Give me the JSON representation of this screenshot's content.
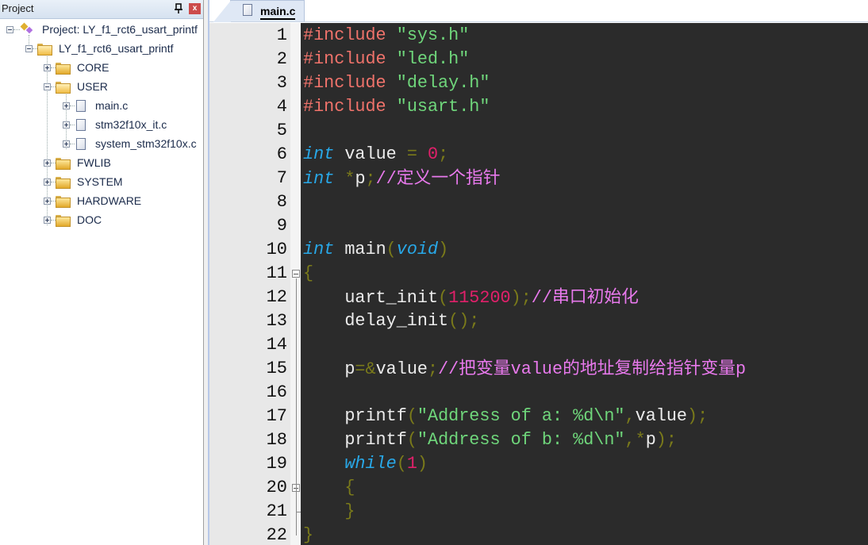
{
  "project_panel": {
    "title": "Project",
    "pin_icon": "pin-icon",
    "close_icon": "close-icon",
    "tree": [
      {
        "label": "Project: LY_f1_rct6_usart_printf",
        "type": "project",
        "expanded": true
      },
      {
        "label": "LY_f1_rct6_usart_printf",
        "type": "target",
        "expanded": true
      },
      {
        "label": "CORE",
        "type": "folder",
        "expanded": false
      },
      {
        "label": "USER",
        "type": "folder",
        "expanded": true
      },
      {
        "label": "main.c",
        "type": "file"
      },
      {
        "label": "stm32f10x_it.c",
        "type": "file"
      },
      {
        "label": "system_stm32f10x.c",
        "type": "file"
      },
      {
        "label": "FWLIB",
        "type": "folder",
        "expanded": false
      },
      {
        "label": "SYSTEM",
        "type": "folder",
        "expanded": false
      },
      {
        "label": "HARDWARE",
        "type": "folder",
        "expanded": false
      },
      {
        "label": "DOC",
        "type": "folder",
        "expanded": false
      }
    ]
  },
  "editor": {
    "active_tab": "main.c",
    "line_numbers": [
      "1",
      "2",
      "3",
      "4",
      "5",
      "6",
      "7",
      "8",
      "9",
      "10",
      "11",
      "12",
      "13",
      "14",
      "15",
      "16",
      "17",
      "18",
      "19",
      "20",
      "21",
      "22"
    ],
    "fold_markers_at_lines": [
      11,
      20
    ],
    "lines": [
      [
        {
          "c": "pp",
          "t": "#include "
        },
        {
          "c": "str",
          "t": "\"sys.h\""
        }
      ],
      [
        {
          "c": "pp",
          "t": "#include "
        },
        {
          "c": "str",
          "t": "\"led.h\""
        }
      ],
      [
        {
          "c": "pp",
          "t": "#include "
        },
        {
          "c": "str",
          "t": "\"delay.h\""
        }
      ],
      [
        {
          "c": "pp",
          "t": "#include "
        },
        {
          "c": "str",
          "t": "\"usart.h\""
        }
      ],
      [],
      [
        {
          "c": "kw",
          "t": "int"
        },
        {
          "c": "id",
          "t": " value "
        },
        {
          "c": "op",
          "t": "="
        },
        {
          "c": "id",
          "t": " "
        },
        {
          "c": "num",
          "t": "0"
        },
        {
          "c": "op",
          "t": ";"
        }
      ],
      [
        {
          "c": "kw",
          "t": "int"
        },
        {
          "c": "id",
          "t": " "
        },
        {
          "c": "op",
          "t": "*"
        },
        {
          "c": "id",
          "t": "p"
        },
        {
          "c": "op",
          "t": ";"
        },
        {
          "c": "cmm",
          "t": "//"
        },
        {
          "c": "cm",
          "t": "定义一个指针"
        }
      ],
      [],
      [],
      [
        {
          "c": "kw",
          "t": "int"
        },
        {
          "c": "id",
          "t": " main"
        },
        {
          "c": "op",
          "t": "("
        },
        {
          "c": "kw",
          "t": "void"
        },
        {
          "c": "op",
          "t": ")"
        }
      ],
      [
        {
          "c": "op",
          "t": "{"
        }
      ],
      [
        {
          "c": "id",
          "t": "    uart_init"
        },
        {
          "c": "op",
          "t": "("
        },
        {
          "c": "num",
          "t": "115200"
        },
        {
          "c": "op",
          "t": ");"
        },
        {
          "c": "cmm",
          "t": "//"
        },
        {
          "c": "cm",
          "t": "串口初始化"
        }
      ],
      [
        {
          "c": "id",
          "t": "    delay_init"
        },
        {
          "c": "op",
          "t": "();"
        }
      ],
      [],
      [
        {
          "c": "id",
          "t": "    p"
        },
        {
          "c": "op",
          "t": "=&"
        },
        {
          "c": "id",
          "t": "value"
        },
        {
          "c": "op",
          "t": ";"
        },
        {
          "c": "cmm",
          "t": "//"
        },
        {
          "c": "cm",
          "t": "把变量"
        },
        {
          "c": "cmm",
          "t": "value"
        },
        {
          "c": "cm",
          "t": "的地址复制给指针变量"
        },
        {
          "c": "cmm",
          "t": "p"
        }
      ],
      [],
      [
        {
          "c": "id",
          "t": "    printf"
        },
        {
          "c": "op",
          "t": "("
        },
        {
          "c": "str",
          "t": "\"Address of a: %d\\n\""
        },
        {
          "c": "op",
          "t": ","
        },
        {
          "c": "id",
          "t": "value"
        },
        {
          "c": "op",
          "t": ");"
        }
      ],
      [
        {
          "c": "id",
          "t": "    printf"
        },
        {
          "c": "op",
          "t": "("
        },
        {
          "c": "str",
          "t": "\"Address of b: %d\\n\""
        },
        {
          "c": "op",
          "t": ",*"
        },
        {
          "c": "id",
          "t": "p"
        },
        {
          "c": "op",
          "t": ");"
        }
      ],
      [
        {
          "c": "id",
          "t": "    "
        },
        {
          "c": "kw",
          "t": "while"
        },
        {
          "c": "op",
          "t": "("
        },
        {
          "c": "num",
          "t": "1"
        },
        {
          "c": "op",
          "t": ")"
        }
      ],
      [
        {
          "c": "id",
          "t": "    "
        },
        {
          "c": "op",
          "t": "{"
        }
      ],
      [
        {
          "c": "id",
          "t": "    "
        },
        {
          "c": "op",
          "t": "}"
        }
      ],
      [
        {
          "c": "op",
          "t": "}"
        }
      ]
    ]
  }
}
